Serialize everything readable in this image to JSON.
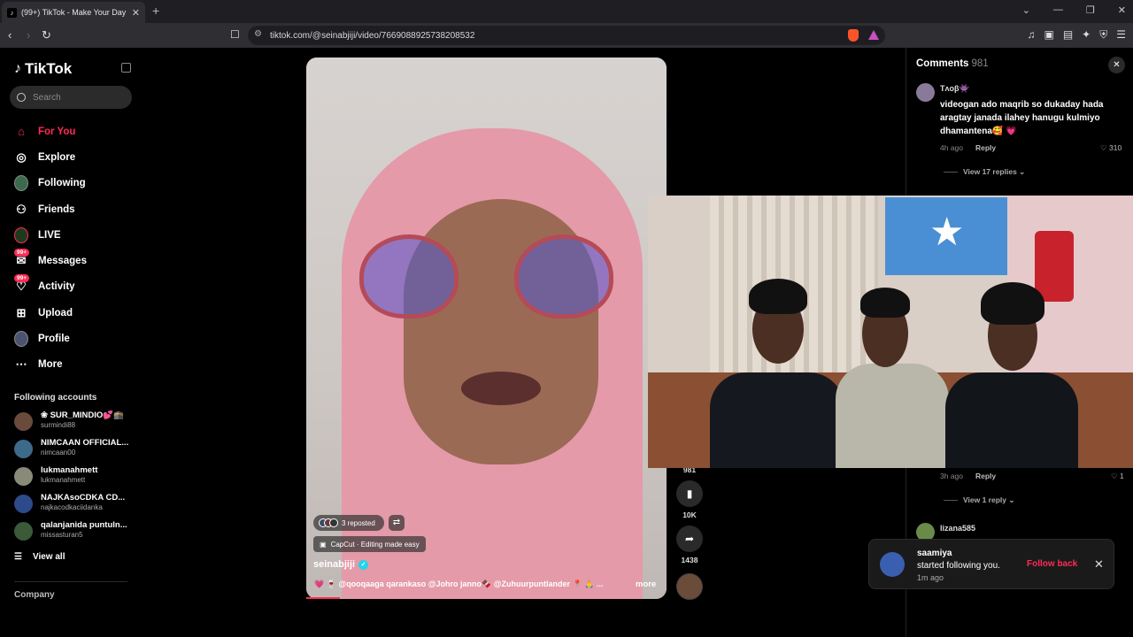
{
  "browser": {
    "tab_title": "(99+) TikTok - Make Your Day",
    "url": "tiktok.com/@seinabjiji/video/7669088925738208532"
  },
  "sidebar": {
    "logo": "TikTok",
    "search_placeholder": "Search",
    "nav": [
      {
        "label": "For You",
        "icon": "home-icon"
      },
      {
        "label": "Explore",
        "icon": "compass-icon"
      },
      {
        "label": "Following",
        "icon": "following-avatar-icon"
      },
      {
        "label": "Friends",
        "icon": "friends-icon"
      },
      {
        "label": "LIVE",
        "icon": "live-icon"
      },
      {
        "label": "Messages",
        "icon": "messages-icon",
        "badge": "99+"
      },
      {
        "label": "Activity",
        "icon": "activity-icon",
        "badge": "99+"
      },
      {
        "label": "Upload",
        "icon": "upload-icon"
      },
      {
        "label": "Profile",
        "icon": "profile-avatar-icon"
      },
      {
        "label": "More",
        "icon": "more-icon"
      }
    ],
    "following_title": "Following accounts",
    "accounts": [
      {
        "name": "❀ SUR_MINDIO💕🕋",
        "handle": "surmindi88"
      },
      {
        "name": "NIMCAAN OFFICIAL...",
        "handle": "nimcaan00"
      },
      {
        "name": "lukmanahmett",
        "handle": "lukmanahmett"
      },
      {
        "name": "NAJKAsoCDKA CD...",
        "handle": "najkacodkaciidanka"
      },
      {
        "name": "qalanjanida puntuln...",
        "handle": "missasturan5"
      }
    ],
    "view_all": "View all",
    "company": "Company"
  },
  "video": {
    "reposted": "3 reposted",
    "capcut": "CapCut · Editing made easy",
    "author": "seinabjiji",
    "caption": "💗 🍷 @qooqaaga qarankaso @Johro janno🍫 @Zuhuurpuntlander 📍 🙏 ...",
    "more": "more"
  },
  "rail": {
    "comments_count": "981",
    "saves_count": "10K",
    "shares_count": "1438"
  },
  "comments": {
    "title": "Comments",
    "count": "981",
    "first": {
      "user": "Tʌᴏβ👾",
      "text": "videogan ado maqrib so dukaday hada aragtay janada ilahey hanugu kulmiyo dhamantena🥰 💗",
      "time": "4h ago",
      "reply": "Reply",
      "likes": "310",
      "view_replies": "View 17 replies"
    },
    "second": {
      "time": "3h ago",
      "reply": "Reply",
      "likes": "1",
      "view_replies": "View 1 reply"
    },
    "third": {
      "user": "lizana585"
    }
  },
  "toast": {
    "name": "saamiya",
    "message": "started following you.",
    "time": "1m ago",
    "action": "Follow back"
  },
  "colors": {
    "accent": "#fe2c55",
    "verified": "#20d5ec",
    "background": "#000000"
  }
}
